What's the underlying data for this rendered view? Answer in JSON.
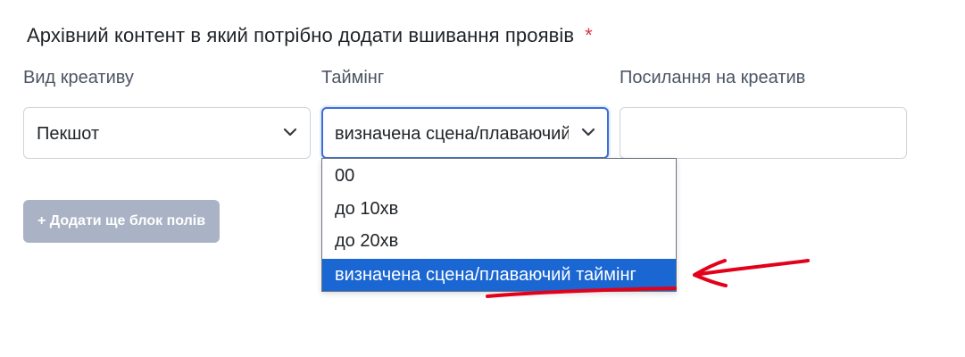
{
  "form": {
    "title": "Архівний контент в який потрібно додати вшивання проявів",
    "required_mark": "*"
  },
  "fields": {
    "creative_type": {
      "label": "Вид креативу",
      "value": "Пекшот"
    },
    "timing": {
      "label": "Таймінг",
      "value": "визначена сцена/плаваючий таймінг"
    },
    "creative_link": {
      "label": "Посилання на креатив",
      "value": ""
    }
  },
  "timing_dropdown": {
    "options": [
      {
        "label": "00",
        "selected": false
      },
      {
        "label": "до 10хв",
        "selected": false
      },
      {
        "label": "до 20хв",
        "selected": false
      },
      {
        "label": "визначена сцена/плаваючий таймінг",
        "selected": true
      }
    ]
  },
  "add_button": {
    "label": "+ Додати ще блок полів"
  },
  "colors": {
    "accent": "#1a66d2",
    "required": "#dc3545",
    "annotation": "#e3001b",
    "button_disabled": "#aab3c5"
  },
  "icons": {
    "select_arrow": "chevron-down-icon"
  }
}
